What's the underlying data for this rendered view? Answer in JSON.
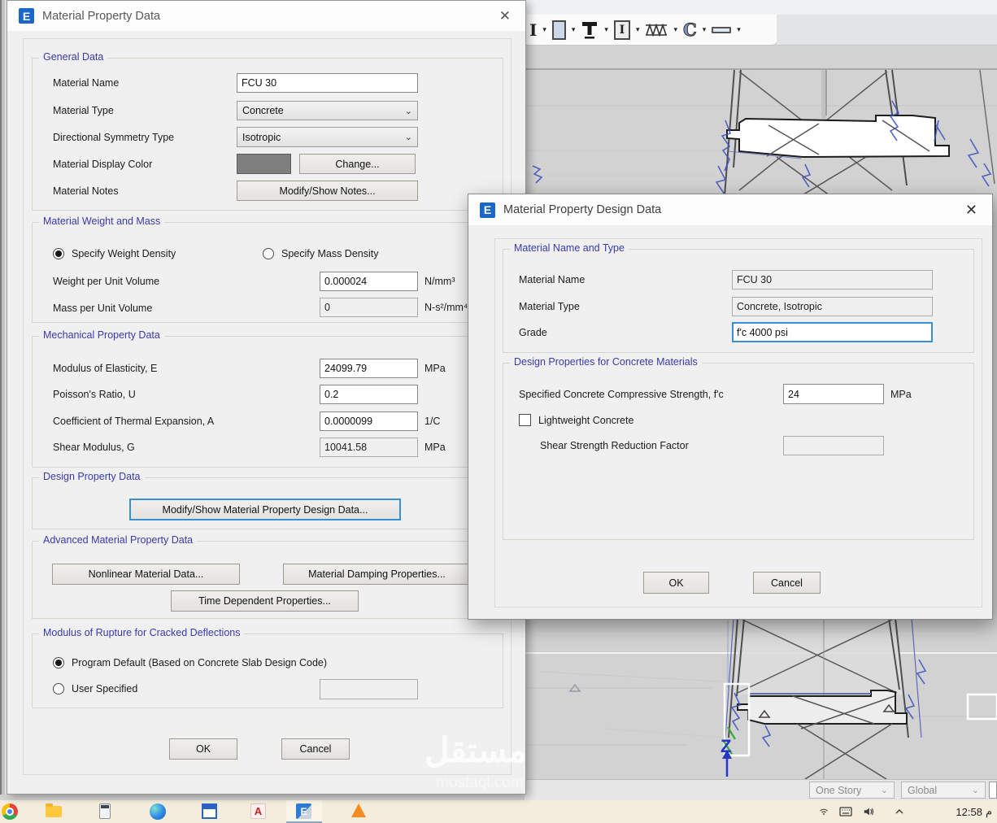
{
  "icons": {
    "close": "✕",
    "dropdown": "▾",
    "chevron": "⌄",
    "logo_letter": "E",
    "autocad_letter": "A",
    "section_i": "I",
    "section_c": "C"
  },
  "dialog1": {
    "title": "Material Property Data",
    "general": {
      "title": "General Data",
      "material_name_label": "Material Name",
      "material_name_value": "FCU 30",
      "material_type_label": "Material Type",
      "material_type_value": "Concrete",
      "symmetry_label": "Directional Symmetry Type",
      "symmetry_value": "Isotropic",
      "color_label": "Material Display Color",
      "change_button": "Change...",
      "notes_label": "Material Notes",
      "notes_button": "Modify/Show Notes..."
    },
    "weight": {
      "title": "Material Weight and Mass",
      "radio_weight_label": "Specify Weight Density",
      "radio_mass_label": "Specify Mass Density",
      "weight_label": "Weight per Unit Volume",
      "weight_value": "0.000024",
      "weight_unit": "N/mm³",
      "mass_label": "Mass per Unit Volume",
      "mass_value": "0",
      "mass_unit": "N-s²/mm⁴"
    },
    "mech": {
      "title": "Mechanical Property Data",
      "rows": [
        {
          "label": "Modulus of Elasticity,  E",
          "value": "24099.79",
          "unit": "MPa"
        },
        {
          "label": "Poisson's Ratio,  U",
          "value": "0.2",
          "unit": ""
        },
        {
          "label": "Coefficient of Thermal Expansion,  A",
          "value": "0.0000099",
          "unit": "1/C"
        },
        {
          "label": "Shear Modulus,  G",
          "value": "10041.58",
          "unit": "MPa"
        }
      ]
    },
    "design": {
      "title": "Design Property Data",
      "button": "Modify/Show Material Property Design Data..."
    },
    "advanced": {
      "title": "Advanced Material Property Data",
      "nonlinear_button": "Nonlinear Material Data...",
      "damping_button": "Material Damping Properties...",
      "time_button": "Time Dependent Properties..."
    },
    "rupture": {
      "title": "Modulus of Rupture for Cracked Deflections",
      "radio_default_label": "Program Default  (Based on Concrete Slab Design Code)",
      "radio_user_label": "User Specified",
      "user_value": ""
    },
    "ok_button": "OK",
    "cancel_button": "Cancel"
  },
  "dialog2": {
    "title": "Material Property Design Data",
    "name_type": {
      "title": "Material Name and Type",
      "name_label": "Material Name",
      "name_value": "FCU 30",
      "type_label": "Material Type",
      "type_value": "Concrete, Isotropic",
      "grade_label": "Grade",
      "grade_value": "f'c 4000 psi"
    },
    "concrete": {
      "title": "Design Properties for Concrete Materials",
      "fc_label": "Specified Concrete Compressive Strength, f'c",
      "fc_value": "24",
      "fc_unit": "MPa",
      "lightweight_label": "Lightweight Concrete",
      "shear_label": "Shear Strength Reduction Factor",
      "shear_value": ""
    },
    "ok_button": "OK",
    "cancel_button": "Cancel"
  },
  "statusbar": {
    "story_selector": "One Story",
    "coord_system_selector": "Global"
  },
  "taskbar": {
    "clock_time": "12:58",
    "clock_meridiem": "م"
  },
  "viewport": {
    "z_axis_label": "Z"
  },
  "watermark": {
    "arabic": "مستقل",
    "domain": "mostaql.com"
  },
  "colors": {
    "accent_blue": "#1b66c9",
    "group_title": "#3939ac",
    "focus_border": "#3a8fd0",
    "material_swatch": "#7f7f7f",
    "taskbar_bg": "#f4edde",
    "viewport_bg": "#d2d2d2",
    "wire_blue": "#3a4fc0"
  }
}
